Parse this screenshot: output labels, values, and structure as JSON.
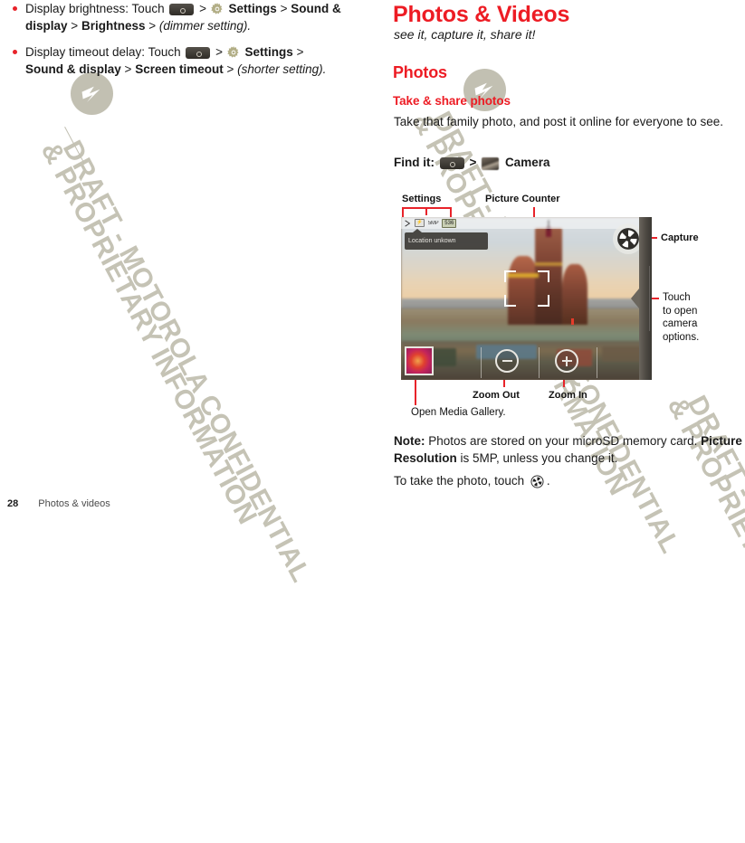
{
  "watermark": {
    "line1": "DRAFT - MOTOROLA CONFIDENTIAL",
    "line2": "& PROPRIETARY INFORMATION",
    "logo_name": "motorola-batwing-logo"
  },
  "left_column": {
    "bullets": [
      {
        "id": "display-brightness",
        "seg1": "Display brightness: Touch",
        "key_icon": "menu-key-icon",
        "sep1": ">",
        "gear_icon": "settings-gear-icon",
        "bold1": "Settings",
        "sep2": ">",
        "bold2": "Sound & display",
        "sep3": ">",
        "bold3": "Brightness",
        "sep4": ">",
        "italic": "(dimmer setting)."
      },
      {
        "id": "display-timeout-delay",
        "seg1": "Display timeout delay: Touch",
        "key_icon": "menu-key-icon",
        "sep1": ">",
        "gear_icon": "settings-gear-icon",
        "bold1": "Settings",
        "sep2": ">",
        "bold2": "Sound & display",
        "sep3": ">",
        "bold3": "Screen timeout",
        "sep4": ">",
        "italic": "(shorter setting)."
      }
    ]
  },
  "right_column": {
    "chapter_title": "Photos & Videos",
    "subtitle": "see it, capture it, share it!",
    "section_title": "Photos",
    "subsection_title": "Take & share photos",
    "intro": "Take that family photo, and post it online for everyone to see.",
    "find_it": {
      "label": "Find it:",
      "key_icon": "menu-key-icon",
      "separator": ">",
      "app_icon": "camera-app-icon",
      "app_name": "Camera"
    },
    "note": {
      "label": "Note:",
      "text1": " Photos are stored on your microSD memory card.",
      "bold2": "Picture Resolution",
      "text2": " is 5MP, unless you change it."
    },
    "take_photo": {
      "text": "To take the photo, touch",
      "icon": "shutter-icon",
      "period": "."
    }
  },
  "figure": {
    "callouts": {
      "settings": "Settings",
      "picture_counter": "Picture Counter",
      "capture": "Capture",
      "camera_options": "Touch\nto open\ncamera\noptions.",
      "camera_options_lines": [
        "Touch",
        "to open",
        "camera",
        "options."
      ],
      "zoom_out": "Zoom Out",
      "zoom_in": "Zoom In",
      "open_gallery": "Open Media Gallery."
    },
    "phone_screen": {
      "status_bar": {
        "chevron_icon": "chevron-right-icon",
        "mode_badge": "flash-icon",
        "resolution": "5MP",
        "picture_count": "536"
      },
      "location_tooltip": "Location unkown",
      "shutter_icon": "shutter-aperture-icon",
      "gallery_thumb_icon": "gallery-thumbnail",
      "zoom_out_icon": "zoom-out-icon",
      "zoom_in_icon": "zoom-in-icon",
      "options_arrow_icon": "camera-options-arrow-icon"
    }
  },
  "footer": {
    "page_number": "28",
    "section_name": "Photos & videos"
  },
  "colors": {
    "accent_red": "#ed1c24",
    "bullet_red": "#e8232a",
    "callout_red": "#e8232a",
    "watermark": "#c2c0b2",
    "body_text": "#1a1a1a"
  }
}
